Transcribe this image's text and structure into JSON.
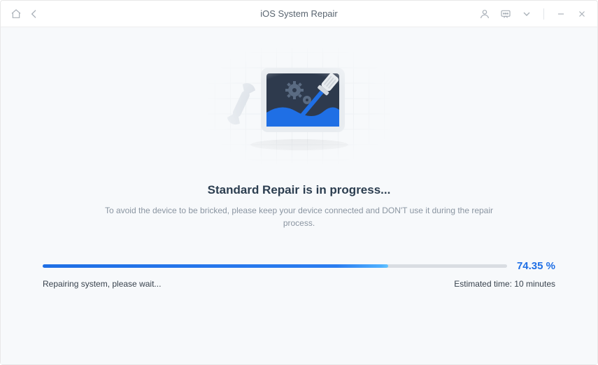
{
  "titlebar": {
    "title": "iOS System Repair"
  },
  "main": {
    "heading": "Standard Repair is in progress...",
    "subtext": "To avoid the device to be bricked, please keep your device connected and DON'T use it during the repair process."
  },
  "progress": {
    "percent_label": "74.35 %",
    "percent_value": 74.35,
    "status_left": "Repairing system, please wait...",
    "status_right": "Estimated time: 10 minutes",
    "fill_width": "74.35%"
  }
}
